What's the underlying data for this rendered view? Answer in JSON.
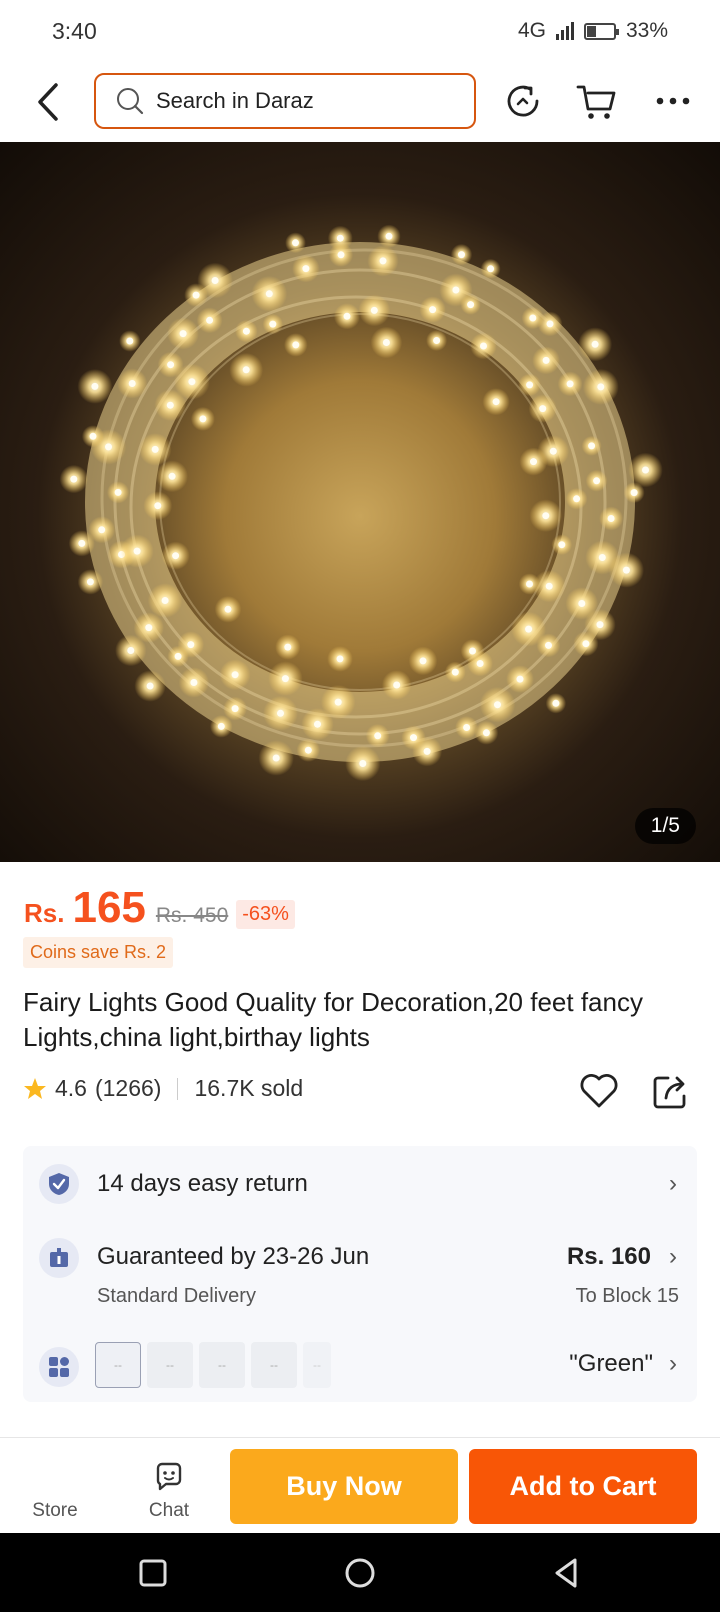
{
  "status_bar": {
    "time": "3:40",
    "network": "4G",
    "battery": "33%",
    "battery_level": 0.33
  },
  "header": {
    "search_placeholder": "Search in Daraz",
    "icons": [
      "back-arrow-icon",
      "search-icon",
      "history-refresh-icon",
      "cart-icon",
      "more-icon"
    ]
  },
  "gallery": {
    "counter": "1/5"
  },
  "price": {
    "currency": "Rs.",
    "current": "165",
    "original": "Rs. 450",
    "discount": "-63%",
    "coins": "Coins save Rs. 2"
  },
  "product": {
    "title": "Fairy Lights Good Quality for Decoration,20 feet fancy Lights,china light,birthay lights",
    "rating": "4.6",
    "reviews": "(1266)",
    "sold": "16.7K sold"
  },
  "info": {
    "return_text": "14 days easy return",
    "delivery_text": "Guaranteed by 23-26 Jun",
    "delivery_type": "Standard Delivery",
    "delivery_price": "Rs. 160",
    "delivery_location": "To Block 15",
    "variant_selected": "\"Green\"",
    "swatch_labels": [
      "--",
      "--",
      "--",
      "--",
      "--"
    ]
  },
  "bottom": {
    "store": "Store",
    "chat": "Chat",
    "buy_now": "Buy Now",
    "add_to_cart": "Add to Cart"
  },
  "colors": {
    "accent": "#f85606",
    "buy": "#fba91c",
    "price": "#f5511e",
    "search_border": "#d6560f"
  }
}
